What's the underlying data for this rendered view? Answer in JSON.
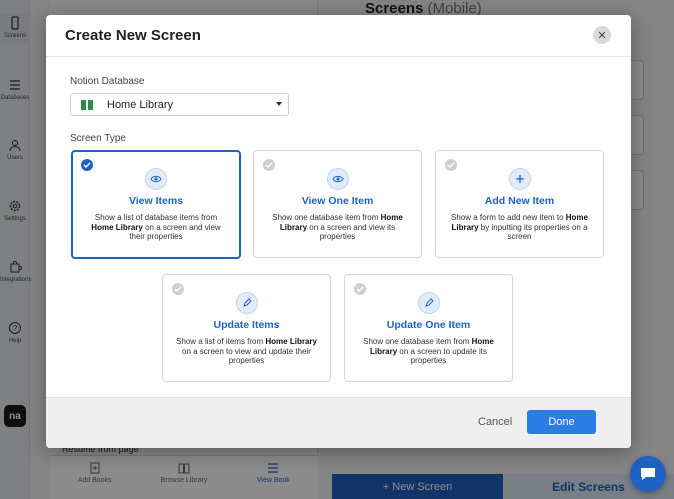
{
  "sidebar": {
    "items": [
      {
        "label": "Screens",
        "icon": "phone-icon"
      },
      {
        "label": "Databases",
        "icon": "list-icon"
      },
      {
        "label": "Users",
        "icon": "users-icon"
      },
      {
        "label": "Settings",
        "icon": "gear-icon"
      },
      {
        "label": "Integrations",
        "icon": "puzzle-icon"
      },
      {
        "label": "Help",
        "icon": "help-icon"
      }
    ],
    "logo_text": "na"
  },
  "left_panel": {
    "resume_text": "Resume from page",
    "bottom_nav": [
      {
        "label": "Add Books",
        "icon": "add-book-icon"
      },
      {
        "label": "Browse Library",
        "icon": "book-icon"
      },
      {
        "label": "View Book",
        "icon": "menu-icon"
      }
    ]
  },
  "right_panel": {
    "title": "Screens",
    "title_suffix": "(Mobile)",
    "new_screen_label": "+ New Screen",
    "edit_screens_label": "Edit Screens"
  },
  "modal": {
    "title": "Create New Screen",
    "notion_db_label": "Notion Database",
    "selected_db": "Home Library",
    "screen_type_label": "Screen Type",
    "cards": [
      {
        "title": "View Items",
        "desc_pre": "Show a list of database items from ",
        "desc_bold": "Home Library",
        "desc_post": " on a screen and view their properties",
        "icon": "eye-icon",
        "selected": true
      },
      {
        "title": "View One Item",
        "desc_pre": "Show one database item from ",
        "desc_bold": "Home Library",
        "desc_post": " on a screen and view its properties",
        "icon": "eye-icon",
        "selected": false
      },
      {
        "title": "Add New Item",
        "desc_pre": "Show a form to add new item to ",
        "desc_bold": "Home Library",
        "desc_post": " by inputting its properties on a screen",
        "icon": "plus-icon",
        "selected": false
      },
      {
        "title": "Update Items",
        "desc_pre": "Show a list of items from ",
        "desc_bold": "Home Library",
        "desc_post": " on a screen to view and update their properties",
        "icon": "pencil-icon",
        "selected": false
      },
      {
        "title": "Update One Item",
        "desc_pre": "Show one database item from ",
        "desc_bold": "Home Library",
        "desc_post": " on a screen to update its properties",
        "icon": "pencil-icon",
        "selected": false
      }
    ],
    "cancel_label": "Cancel",
    "done_label": "Done"
  },
  "colors": {
    "accent": "#1f62c4",
    "done_button": "#2b7de6"
  }
}
